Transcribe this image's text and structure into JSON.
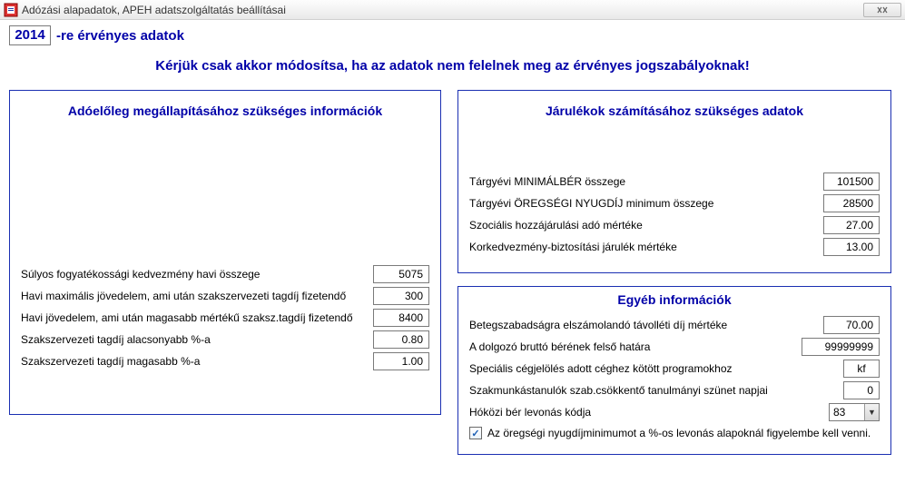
{
  "window": {
    "title": "Adózási alapadatok, APEH adatszolgáltatás beállításai"
  },
  "year": {
    "value": "2014",
    "suffix": "-re érvényes adatok"
  },
  "warning": "Kérjük csak akkor módosítsa, ha az adatok nem felelnek meg az érvényes jogszabályoknak!",
  "panels": {
    "advance": {
      "title": "Adóelőleg megállapításához szükséges információk",
      "rows": {
        "disability_label": "Súlyos fogyatékossági kedvezmény havi összege",
        "disability_value": "5075",
        "maxincome_label": "Havi maximális jövedelem, ami után szakszervezeti tagdíj fizetendő",
        "maxincome_value": "300",
        "higherincome_label": "Havi jövedelem, ami után magasabb mértékű szaksz.tagdíj fizetendő",
        "higherincome_value": "8400",
        "union_low_label": "Szakszervezeti tagdíj alacsonyabb %-a",
        "union_low_value": "0.80",
        "union_high_label": "Szakszervezeti tagdíj magasabb %-a",
        "union_high_value": "1.00"
      }
    },
    "contrib": {
      "title": "Járulékok számításához szükséges adatok",
      "rows": {
        "minwage_label": "Tárgyévi MINIMÁLBÉR összege",
        "minwage_value": "101500",
        "pension_label": "Tárgyévi ÖREGSÉGI NYUGDÍJ minimum összege",
        "pension_value": "28500",
        "social_label": "Szociális hozzájárulási adó mértéke",
        "social_value": "27.00",
        "agepref_label": "Korkedvezmény-biztosítási járulék mértéke",
        "agepref_value": "13.00"
      }
    },
    "misc": {
      "title": "Egyéb információk",
      "rows": {
        "sickpay_label": "Betegszabadságra elszámolandó távolléti díj mértéke",
        "sickpay_value": "70.00",
        "grosscap_label": "A dolgozó bruttó bérének felső határa",
        "grosscap_value": "99999999",
        "company_label": "Speciális cégjelölés adott céghez kötött programokhoz",
        "company_value": "kf",
        "apprentice_label": "Szakmunkástanulók szab.csökkentő tanulmányi szünet napjai",
        "apprentice_value": "0",
        "midmonth_label": "Hóközi bér levonás kódja",
        "midmonth_value": "83",
        "checkbox_label": "Az öregségi nyugdíjminimumot a %-os levonás alapoknál figyelembe kell venni.",
        "checkbox_checked": "✓"
      }
    }
  }
}
